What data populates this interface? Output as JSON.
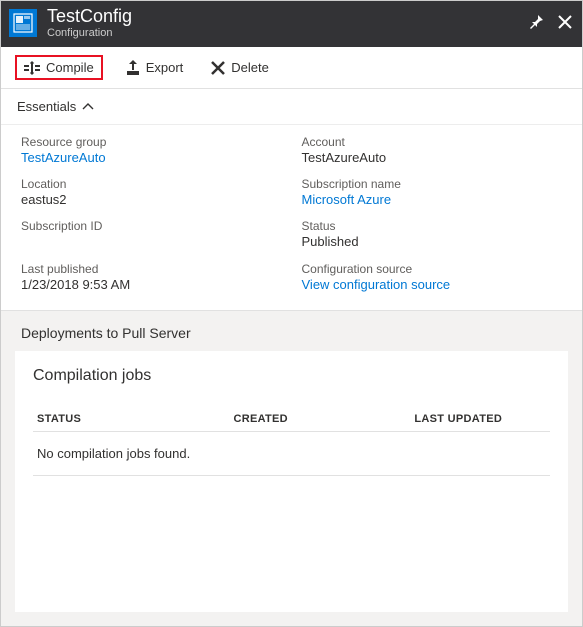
{
  "header": {
    "title": "TestConfig",
    "subtitle": "Configuration"
  },
  "toolbar": {
    "compile_label": "Compile",
    "export_label": "Export",
    "delete_label": "Delete"
  },
  "essentials": {
    "toggle_label": "Essentials",
    "left": [
      {
        "label": "Resource group",
        "value": "TestAzureAuto",
        "link": true
      },
      {
        "label": "Location",
        "value": "eastus2",
        "link": false
      },
      {
        "label": "Subscription ID",
        "value": "",
        "link": false
      },
      {
        "label": "Last published",
        "value": "1/23/2018 9:53 AM",
        "link": false
      }
    ],
    "right": [
      {
        "label": "Account",
        "value": "TestAzureAuto",
        "link": false
      },
      {
        "label": "Subscription name",
        "value": "Microsoft Azure",
        "link": true
      },
      {
        "label": "Status",
        "value": "Published",
        "link": false
      },
      {
        "label": "Configuration source",
        "value": "View configuration source",
        "link": true
      }
    ]
  },
  "deployments": {
    "section_title": "Deployments to Pull Server",
    "panel_title": "Compilation jobs",
    "columns": {
      "status": "STATUS",
      "created": "CREATED",
      "last_updated": "LAST UPDATED"
    },
    "empty_message": "No compilation jobs found."
  }
}
